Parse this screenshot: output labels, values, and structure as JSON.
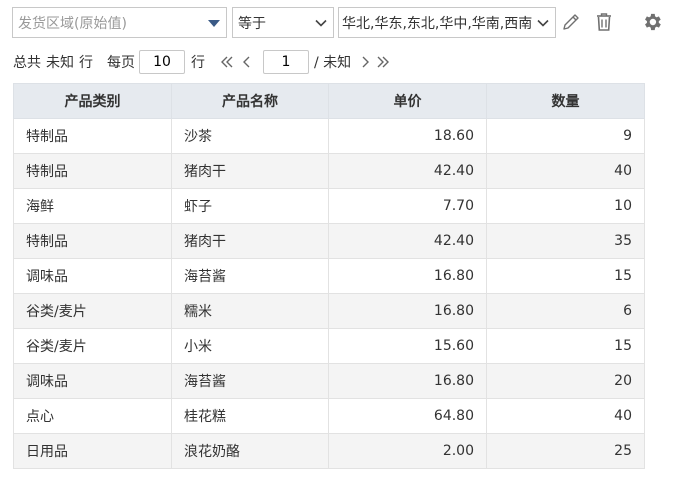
{
  "filter": {
    "field_placeholder": "发货区域(原始值)",
    "operator": "等于",
    "values": "华北,华东,东北,华中,华南,西南"
  },
  "pager": {
    "total_label": "总共",
    "total_value": "未知",
    "total_unit": "行",
    "per_page_label": "每页",
    "per_page_value": "10",
    "per_page_unit": "行",
    "current_page": "1",
    "page_total": "/ 未知"
  },
  "table": {
    "columns": [
      "产品类别",
      "产品名称",
      "单价",
      "数量"
    ],
    "rows": [
      [
        "特制品",
        "沙茶",
        "18.60",
        "9"
      ],
      [
        "特制品",
        "猪肉干",
        "42.40",
        "40"
      ],
      [
        "海鲜",
        "虾子",
        "7.70",
        "10"
      ],
      [
        "特制品",
        "猪肉干",
        "42.40",
        "35"
      ],
      [
        "调味品",
        "海苔酱",
        "16.80",
        "15"
      ],
      [
        "谷类/麦片",
        "糯米",
        "16.80",
        "6"
      ],
      [
        "谷类/麦片",
        "小米",
        "15.60",
        "15"
      ],
      [
        "调味品",
        "海苔酱",
        "16.80",
        "20"
      ],
      [
        "点心",
        "桂花糕",
        "64.80",
        "40"
      ],
      [
        "日用品",
        "浪花奶酪",
        "2.00",
        "25"
      ]
    ]
  },
  "colors": {
    "header_bg": "#e6eaef",
    "zebra_bg": "#f4f4f4",
    "caret": "#3a5a86",
    "icon": "#707070"
  },
  "icons": [
    "caret-down-icon",
    "chevron-down-icon",
    "pencil-icon",
    "trash-icon",
    "gear-icon",
    "double-left-icon",
    "left-icon",
    "right-icon",
    "double-right-icon"
  ]
}
